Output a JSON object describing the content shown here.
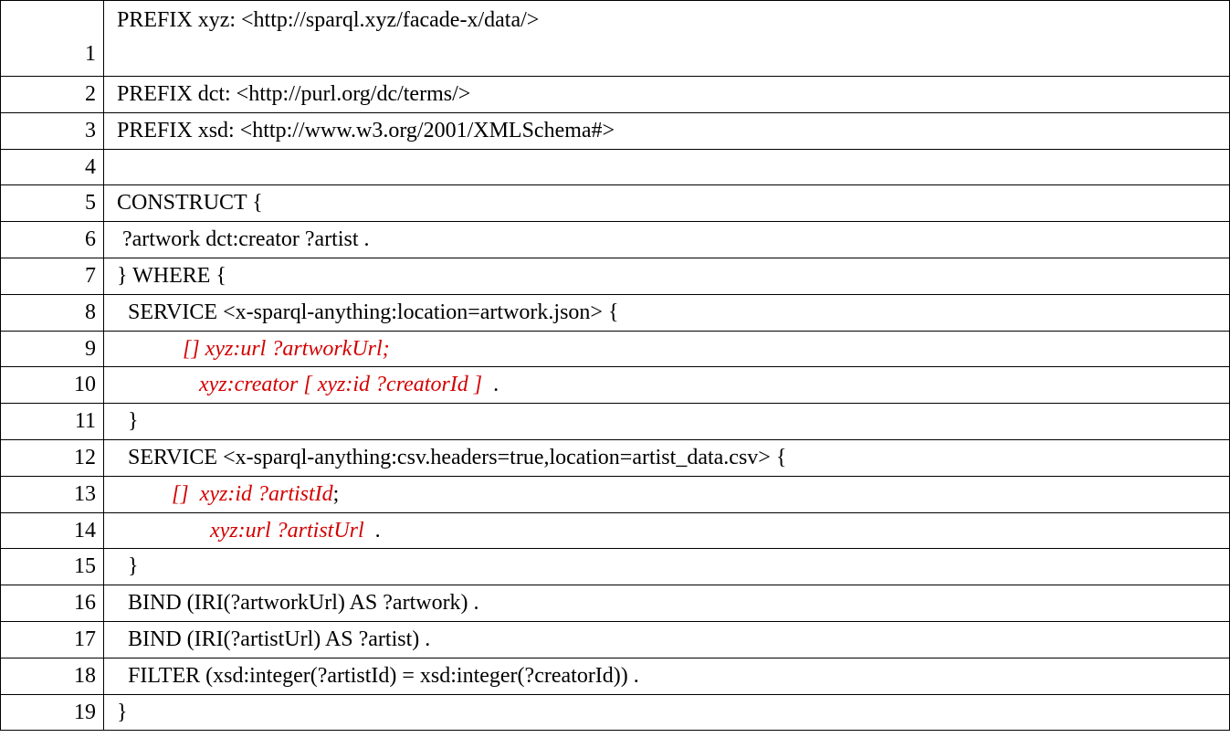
{
  "rows": [
    {
      "line": "1",
      "tall": true,
      "segments": [
        {
          "text": " PREFIX xyz: <http://sparql.xyz/facade-x/data/>"
        }
      ]
    },
    {
      "line": "2",
      "segments": [
        {
          "text": " PREFIX dct: <http://purl.org/dc/terms/>"
        }
      ]
    },
    {
      "line": "3",
      "segments": [
        {
          "text": " PREFIX xsd: <http://www.w3.org/2001/XMLSchema#>"
        }
      ]
    },
    {
      "line": "4",
      "segments": [
        {
          "text": ""
        }
      ]
    },
    {
      "line": "5",
      "segments": [
        {
          "text": " CONSTRUCT {"
        }
      ]
    },
    {
      "line": "6",
      "segments": [
        {
          "text": "  ?artwork dct:creator ?artist ."
        }
      ]
    },
    {
      "line": "7",
      "segments": [
        {
          "text": " } WHERE {"
        }
      ]
    },
    {
      "line": "8",
      "segments": [
        {
          "text": "   SERVICE <x-sparql-anything:location=artwork.json> {"
        }
      ]
    },
    {
      "line": "9",
      "segments": [
        {
          "text": "             "
        },
        {
          "text": "[] xyz:url ?artworkUrl;",
          "red": true
        }
      ]
    },
    {
      "line": "10",
      "segments": [
        {
          "text": "                "
        },
        {
          "text": "xyz:creator [ xyz:id ?creatorId ] ",
          "red": true
        },
        {
          "text": " ."
        }
      ]
    },
    {
      "line": "11",
      "segments": [
        {
          "text": "   }"
        }
      ]
    },
    {
      "line": "12",
      "segments": [
        {
          "text": "   SERVICE <x-sparql-anything:csv.headers=true,location=artist_data.csv> {"
        }
      ]
    },
    {
      "line": "13",
      "segments": [
        {
          "text": "           "
        },
        {
          "text": "[]  xyz:id ?artistId",
          "red": true
        },
        {
          "text": ";"
        }
      ]
    },
    {
      "line": "14",
      "segments": [
        {
          "text": "                  "
        },
        {
          "text": "xyz:url ?artistUrl ",
          "red": true
        },
        {
          "text": " ."
        }
      ]
    },
    {
      "line": "15",
      "segments": [
        {
          "text": "   }"
        }
      ]
    },
    {
      "line": "16",
      "segments": [
        {
          "text": "   BIND (IRI(?artworkUrl) AS ?artwork) ."
        }
      ]
    },
    {
      "line": "17",
      "segments": [
        {
          "text": "   BIND (IRI(?artistUrl) AS ?artist) ."
        }
      ]
    },
    {
      "line": "18",
      "segments": [
        {
          "text": "   FILTER (xsd:integer(?artistId) = xsd:integer(?creatorId)) ."
        }
      ]
    },
    {
      "line": "19",
      "segments": [
        {
          "text": " }"
        }
      ]
    }
  ]
}
